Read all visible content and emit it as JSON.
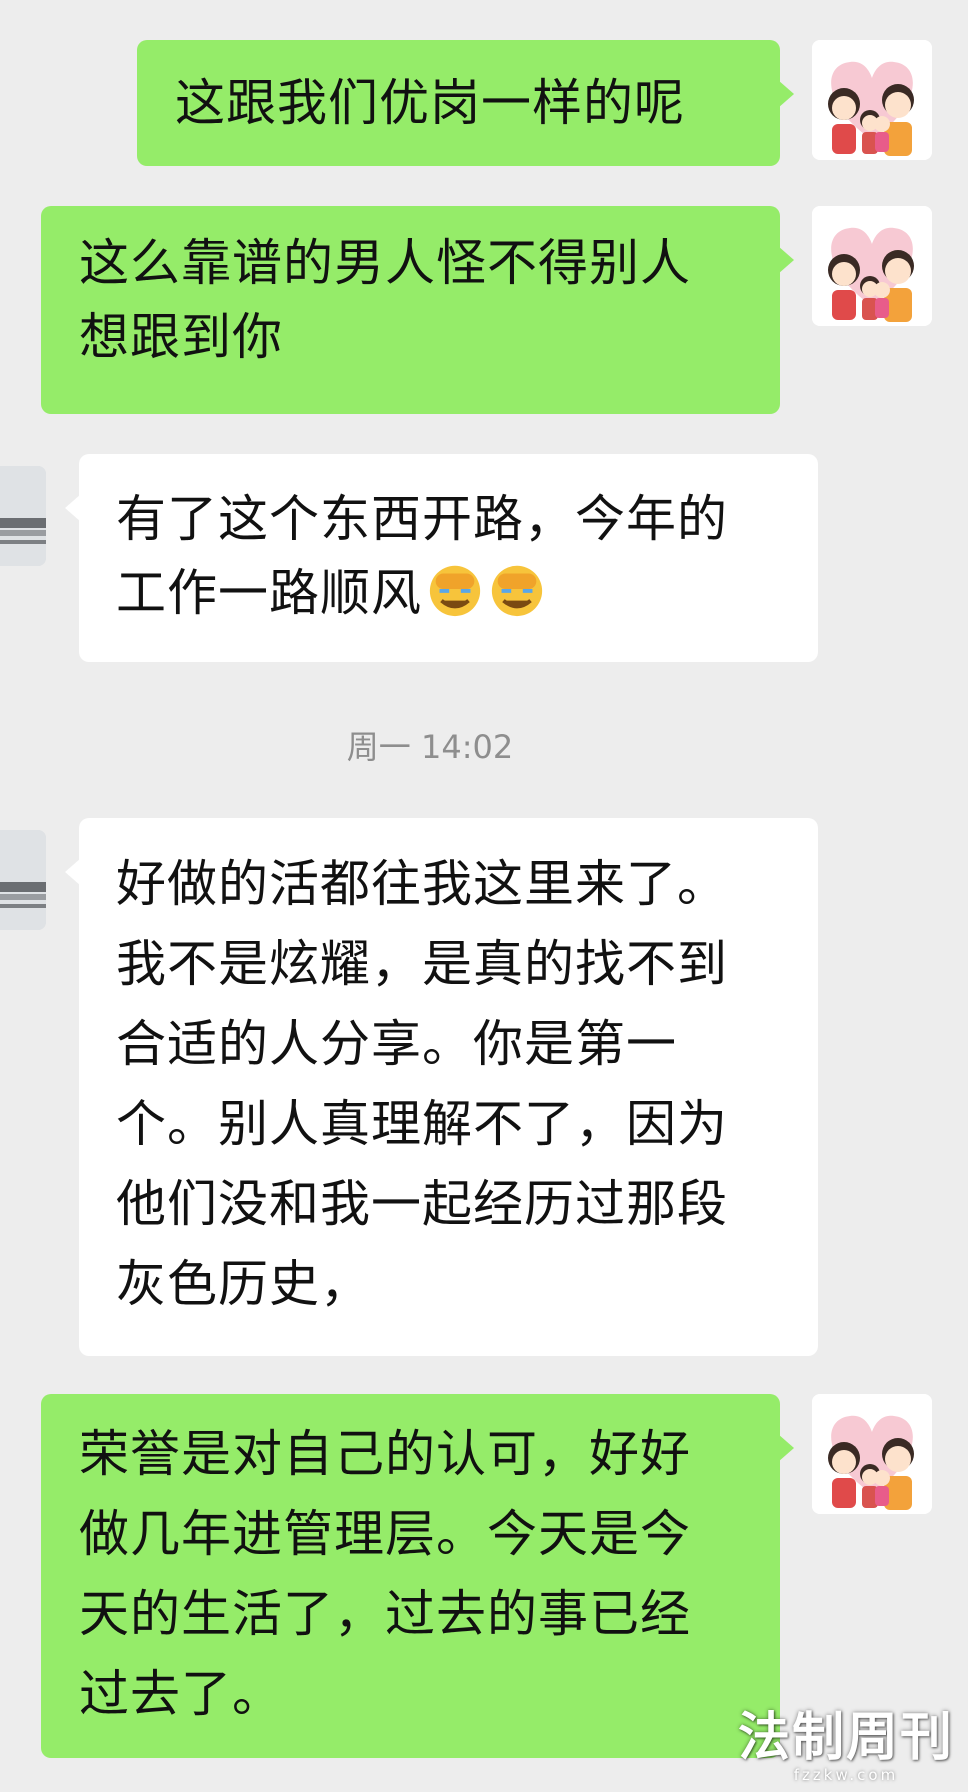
{
  "messages": [
    {
      "side": "sent",
      "lines": [
        "这跟我们优岗一样的呢"
      ]
    },
    {
      "side": "sent",
      "lines": [
        "这么靠谱的男人怪不得别人",
        "想跟到你"
      ]
    },
    {
      "side": "received",
      "lines": [
        "有了这个东西开路，今年的",
        "工作一路顺风"
      ],
      "emoji": [
        "face-palm-emoji",
        "face-palm-emoji"
      ]
    },
    {
      "side": "received",
      "lines": [
        "好做的活都往我这里来了。",
        "我不是炫耀，是真的找不到",
        "合适的人分享。你是第一",
        "个。别人真理解不了，因为",
        "他们没和我一起经历过那段",
        "灰色历史，"
      ]
    },
    {
      "side": "sent",
      "lines": [
        "荣誉是对自己的认可，好好",
        "做几年进管理层。今天是今",
        "天的生活了，过去的事已经",
        "过去了。"
      ]
    }
  ],
  "timestamp": "周一 14:02",
  "watermark": {
    "title": "法制周刊",
    "site": "fzzkw.com"
  },
  "colors": {
    "sent_bubble": "#95ec69",
    "received_bubble": "#ffffff",
    "background": "#ededed",
    "timestamp": "#8e8e8e"
  }
}
